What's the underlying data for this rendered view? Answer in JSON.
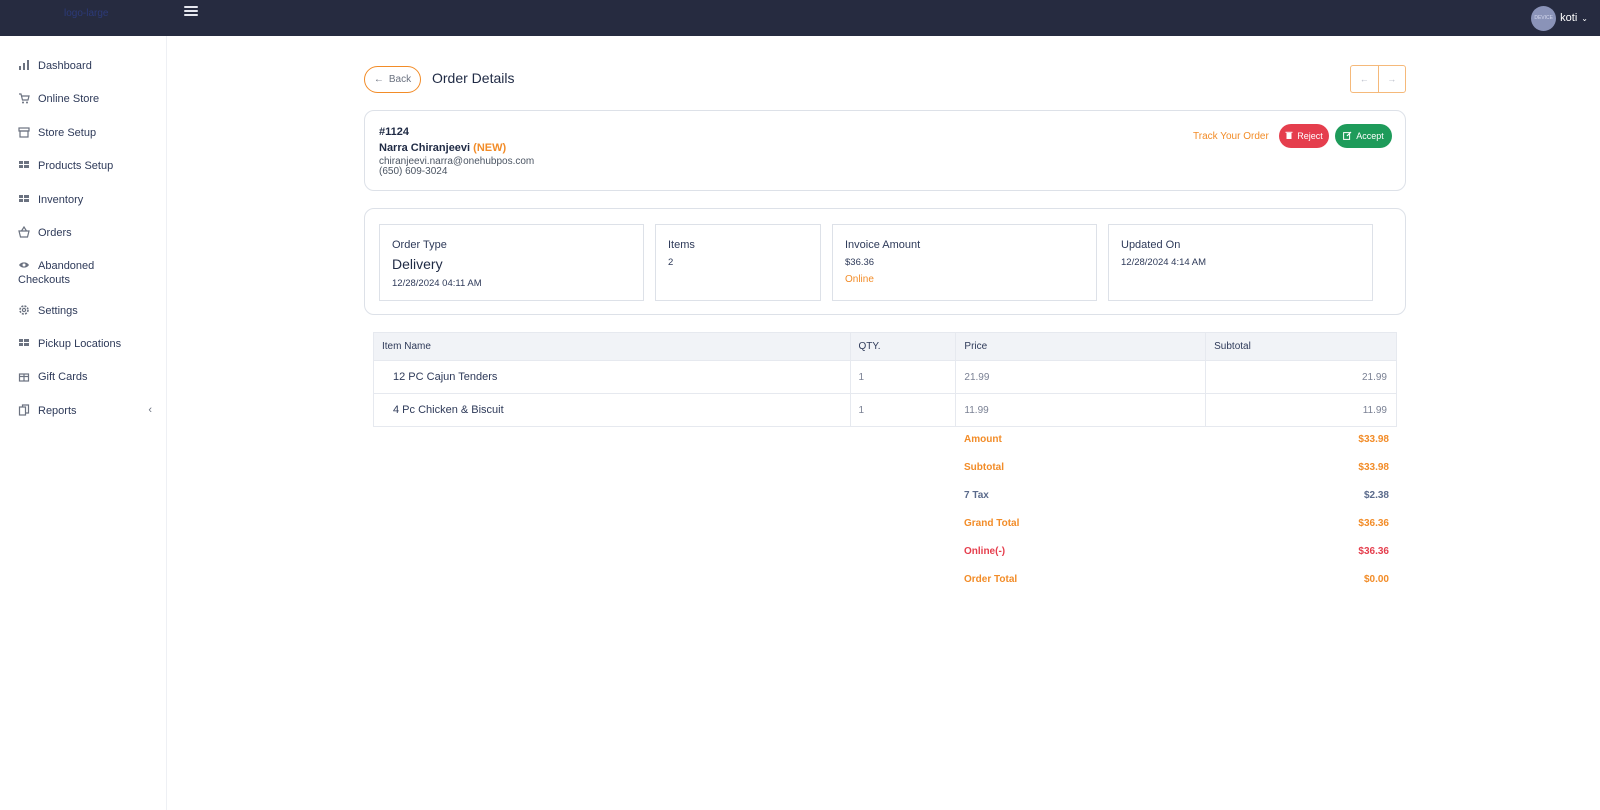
{
  "app": {
    "logo_text": "logo-large"
  },
  "header": {
    "user_name": "koti",
    "avatar_text": "DEVICE"
  },
  "sidebar": {
    "items": [
      {
        "label": "Dashboard",
        "icon": "chart-icon"
      },
      {
        "label": "Online Store",
        "icon": "cart-icon"
      },
      {
        "label": "Store Setup",
        "icon": "store-icon"
      },
      {
        "label": "Products Setup",
        "icon": "grid-icon"
      },
      {
        "label": "Inventory",
        "icon": "grid-icon"
      },
      {
        "label": "Orders",
        "icon": "basket-icon"
      },
      {
        "label": "Abandoned\nCheckouts",
        "icon": "eye-icon"
      },
      {
        "label": "Settings",
        "icon": "gear-icon"
      },
      {
        "label": "Pickup Locations",
        "icon": "grid-icon"
      },
      {
        "label": "Gift Cards",
        "icon": "gift-icon"
      },
      {
        "label": "Reports",
        "icon": "copy-icon"
      }
    ]
  },
  "page": {
    "back_label": "Back",
    "title": "Order Details"
  },
  "order": {
    "number": "#1124",
    "customer_name": "Narra Chiranjeevi",
    "status": "(NEW)",
    "email": "chiranjeevi.narra@onehubpos.com",
    "phone": "(650) 609-3024",
    "track_label": "Track Your Order",
    "reject_label": "Reject",
    "accept_label": "Accept"
  },
  "summary": {
    "order_type_label": "Order Type",
    "order_type": "Delivery",
    "order_date": "12/28/2024 04:11 AM",
    "items_label": "Items",
    "items_count": "2",
    "invoice_label": "Invoice Amount",
    "invoice_amount": "$36.36",
    "payment_method": "Online",
    "updated_label": "Updated On",
    "updated_on": "12/28/2024 4:14 AM"
  },
  "table": {
    "headers": [
      "Item Name",
      "QTY.",
      "Price",
      "Subtotal"
    ],
    "rows": [
      {
        "name": "12 PC Cajun Tenders",
        "qty": "1",
        "price": "21.99",
        "subtotal": "21.99"
      },
      {
        "name": "4 Pc Chicken & Biscuit",
        "qty": "1",
        "price": "11.99",
        "subtotal": "11.99"
      }
    ]
  },
  "totals": [
    {
      "label": "Amount",
      "value": "$33.98",
      "color": "#f28c28"
    },
    {
      "label": "Subtotal",
      "value": "$33.98",
      "color": "#f28c28"
    },
    {
      "label": "7 Tax",
      "value": "$2.38",
      "color": "#5b6b8c"
    },
    {
      "label": "Grand Total",
      "value": "$36.36",
      "color": "#f28c28"
    },
    {
      "label": "Online(-)",
      "value": "$36.36",
      "color": "#e53e4d"
    },
    {
      "label": "Order Total",
      "value": "$0.00",
      "color": "#f28c28"
    }
  ],
  "colors": {
    "topbar": "#262b40",
    "accent": "#f28c28",
    "reject": "#e53e4d",
    "accept": "#1e9b5a"
  }
}
